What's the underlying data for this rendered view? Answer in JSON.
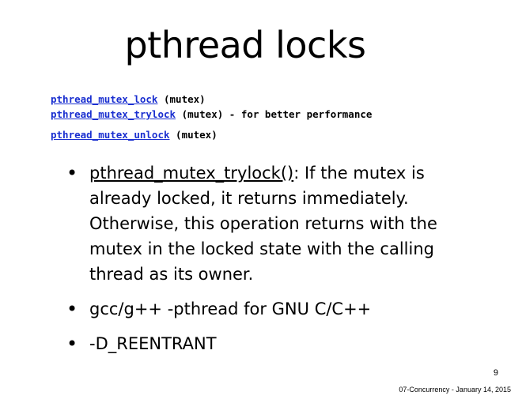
{
  "title": "pthread locks",
  "code_lines": [
    {
      "link": "pthread_mutex_lock",
      "rest": " (mutex)"
    },
    {
      "link": "pthread_mutex_trylock",
      "rest": " (mutex) - for better performance"
    },
    {
      "link": "pthread_mutex_unlock",
      "rest": " (mutex)"
    }
  ],
  "bullets": [
    {
      "term": "pthread_mutex_trylock()",
      "text": ": If the mutex is already locked,  it returns immediately. Otherwise, this operation returns with the mutex in the locked state with the calling thread as its owner."
    },
    {
      "text": "gcc/g++ -pthread for GNU C/C++"
    },
    {
      "text": "-D_REENTRANT"
    }
  ],
  "bullet_glyph": "•",
  "page_number": "9",
  "footer": "07-Concurrency - January 14, 2015"
}
